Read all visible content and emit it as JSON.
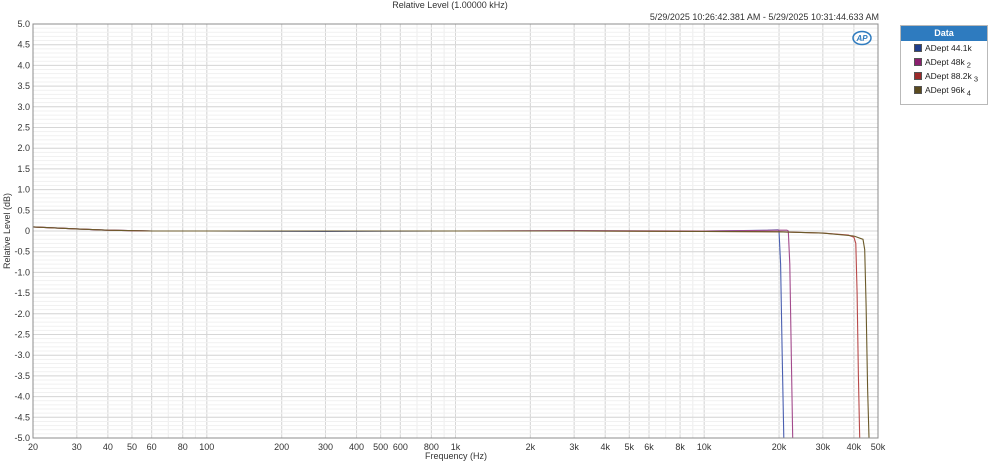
{
  "chart_data": {
    "type": "line",
    "title": "Relative Level (1.00000 kHz)",
    "timestamp": "5/29/2025 10:26:42.381 AM - 5/29/2025 10:31:44.633 AM",
    "xlabel": "Frequency (Hz)",
    "ylabel": "Relative Level (dB)",
    "xscale": "log",
    "xlim": [
      20,
      50000
    ],
    "ylim": [
      -5.0,
      5.0
    ],
    "grid": true,
    "legend_position": "right",
    "legend_title": "Data",
    "x_ticks": [
      {
        "value": 20,
        "label": "20"
      },
      {
        "value": 30,
        "label": "30"
      },
      {
        "value": 40,
        "label": "40"
      },
      {
        "value": 50,
        "label": "50"
      },
      {
        "value": 60,
        "label": "60"
      },
      {
        "value": 80,
        "label": "80"
      },
      {
        "value": 100,
        "label": "100"
      },
      {
        "value": 200,
        "label": "200"
      },
      {
        "value": 300,
        "label": "300"
      },
      {
        "value": 400,
        "label": "400"
      },
      {
        "value": 500,
        "label": "500"
      },
      {
        "value": 600,
        "label": "600"
      },
      {
        "value": 800,
        "label": "800"
      },
      {
        "value": 1000,
        "label": "1k"
      },
      {
        "value": 2000,
        "label": "2k"
      },
      {
        "value": 3000,
        "label": "3k"
      },
      {
        "value": 4000,
        "label": "4k"
      },
      {
        "value": 5000,
        "label": "5k"
      },
      {
        "value": 6000,
        "label": "6k"
      },
      {
        "value": 8000,
        "label": "8k"
      },
      {
        "value": 10000,
        "label": "10k"
      },
      {
        "value": 20000,
        "label": "20k"
      },
      {
        "value": 30000,
        "label": "30k"
      },
      {
        "value": 40000,
        "label": "40k"
      },
      {
        "value": 50000,
        "label": "50k"
      }
    ],
    "y_ticks": [
      {
        "value": 5.0,
        "label": "5.0"
      },
      {
        "value": 4.5,
        "label": "4.5"
      },
      {
        "value": 4.0,
        "label": "4.0"
      },
      {
        "value": 3.5,
        "label": "3.5"
      },
      {
        "value": 3.0,
        "label": "3.0"
      },
      {
        "value": 2.5,
        "label": "2.5"
      },
      {
        "value": 2.0,
        "label": "2.0"
      },
      {
        "value": 1.5,
        "label": "1.5"
      },
      {
        "value": 1.0,
        "label": "1.0"
      },
      {
        "value": 0.5,
        "label": "0.5"
      },
      {
        "value": 0.0,
        "label": "0"
      },
      {
        "value": -0.5,
        "label": "-0.5"
      },
      {
        "value": -1.0,
        "label": "-1.0"
      },
      {
        "value": -1.5,
        "label": "-1.5"
      },
      {
        "value": -2.0,
        "label": "-2.0"
      },
      {
        "value": -2.5,
        "label": "-2.5"
      },
      {
        "value": -3.0,
        "label": "-3.0"
      },
      {
        "value": -3.5,
        "label": "-3.5"
      },
      {
        "value": -4.0,
        "label": "-4.0"
      },
      {
        "value": -4.5,
        "label": "-4.5"
      },
      {
        "value": -5.0,
        "label": "-5.0"
      }
    ],
    "series": [
      {
        "name": "ADept 44.1k",
        "legend_suffix": "",
        "color": "#4a5fb0",
        "swatch": "#1f3d8c",
        "x": [
          20,
          30,
          40,
          60,
          100,
          300,
          1000,
          3000,
          10000,
          18000,
          19800,
          20000,
          20300,
          20600,
          20900
        ],
        "y": [
          0.1,
          0.05,
          0.02,
          0.0,
          0.0,
          -0.01,
          0.0,
          0.0,
          0.0,
          0.02,
          0.03,
          0.0,
          -0.8,
          -3.0,
          -5.0
        ]
      },
      {
        "name": "ADept 48k",
        "legend_suffix": "2",
        "color": "#a34a8c",
        "swatch": "#8a1f6e",
        "x": [
          20,
          30,
          40,
          60,
          100,
          300,
          1000,
          3000,
          10000,
          20000,
          21500,
          21800,
          22100,
          22400,
          22700
        ],
        "y": [
          0.1,
          0.05,
          0.02,
          0.0,
          0.0,
          0.0,
          0.0,
          0.01,
          0.0,
          0.02,
          0.02,
          0.0,
          -0.8,
          -3.0,
          -5.0
        ]
      },
      {
        "name": "ADept 88.2k",
        "legend_suffix": "3",
        "color": "#b84a4a",
        "swatch": "#9c2a2a",
        "x": [
          20,
          30,
          40,
          60,
          100,
          300,
          1000,
          3000,
          10000,
          20000,
          30000,
          38000,
          40000,
          40700,
          41200,
          41700,
          42200
        ],
        "y": [
          0.1,
          0.05,
          0.02,
          0.0,
          0.0,
          0.0,
          0.0,
          0.0,
          -0.01,
          -0.02,
          -0.05,
          -0.1,
          -0.15,
          -0.3,
          -1.5,
          -3.5,
          -5.0
        ]
      },
      {
        "name": "ADept 96k",
        "legend_suffix": "4",
        "color": "#6b5a2a",
        "swatch": "#5a4a1e",
        "x": [
          20,
          30,
          40,
          60,
          100,
          300,
          1000,
          3000,
          10000,
          20000,
          30000,
          40000,
          43500,
          44200,
          44800,
          45400,
          46000
        ],
        "y": [
          0.1,
          0.05,
          0.02,
          0.0,
          0.0,
          0.0,
          0.0,
          0.0,
          -0.01,
          -0.02,
          -0.05,
          -0.12,
          -0.2,
          -0.45,
          -1.8,
          -3.8,
          -5.0
        ]
      }
    ]
  },
  "logo": {
    "text": "AP"
  }
}
